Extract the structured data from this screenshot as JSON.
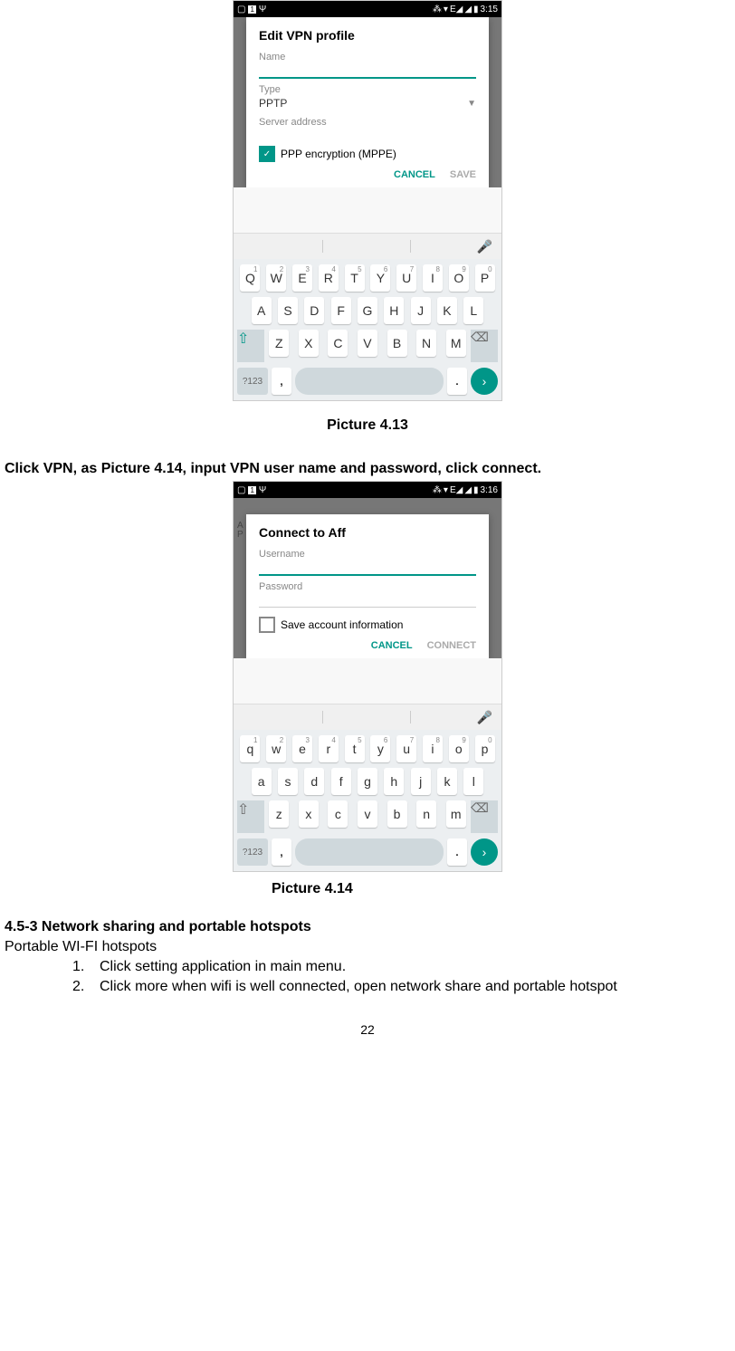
{
  "screenshot1": {
    "status_time": "3:15",
    "dialog_title": "Edit VPN profile",
    "name_label": "Name",
    "type_label": "Type",
    "type_value": "PPTP",
    "server_label": "Server address",
    "checkbox_label": "PPP encryption (MPPE)",
    "cancel": "CANCEL",
    "save": "SAVE",
    "keys_row1": [
      {
        "k": "Q",
        "s": "1"
      },
      {
        "k": "W",
        "s": "2"
      },
      {
        "k": "E",
        "s": "3"
      },
      {
        "k": "R",
        "s": "4"
      },
      {
        "k": "T",
        "s": "5"
      },
      {
        "k": "Y",
        "s": "6"
      },
      {
        "k": "U",
        "s": "7"
      },
      {
        "k": "I",
        "s": "8"
      },
      {
        "k": "O",
        "s": "9"
      },
      {
        "k": "P",
        "s": "0"
      }
    ],
    "keys_row2": [
      "A",
      "S",
      "D",
      "F",
      "G",
      "H",
      "J",
      "K",
      "L"
    ],
    "keys_row3": [
      "Z",
      "X",
      "C",
      "V",
      "B",
      "N",
      "M"
    ],
    "key_123": "?123"
  },
  "caption1": "Picture 4.13",
  "para1": "Click VPN, as Picture 4.14, input VPN user name and password, click connect.",
  "screenshot2": {
    "status_time": "3:16",
    "back_a": "A",
    "back_p": "P",
    "dialog_title": "Connect to Aff",
    "username_label": "Username",
    "password_label": "Password",
    "checkbox_label": "Save account information",
    "cancel": "CANCEL",
    "connect": "CONNECT",
    "keys_row1": [
      {
        "k": "q",
        "s": "1"
      },
      {
        "k": "w",
        "s": "2"
      },
      {
        "k": "e",
        "s": "3"
      },
      {
        "k": "r",
        "s": "4"
      },
      {
        "k": "t",
        "s": "5"
      },
      {
        "k": "y",
        "s": "6"
      },
      {
        "k": "u",
        "s": "7"
      },
      {
        "k": "i",
        "s": "8"
      },
      {
        "k": "o",
        "s": "9"
      },
      {
        "k": "p",
        "s": "0"
      }
    ],
    "keys_row2": [
      "a",
      "s",
      "d",
      "f",
      "g",
      "h",
      "j",
      "k",
      "l"
    ],
    "keys_row3": [
      "z",
      "x",
      "c",
      "v",
      "b",
      "n",
      "m"
    ],
    "key_123": "?123"
  },
  "caption2": "Picture 4.14",
  "heading": "4.5-3 Network sharing and portable hotspots",
  "subheading": "Portable WI-FI hotspots",
  "list": [
    {
      "n": "1.",
      "t": "Click setting application in main menu."
    },
    {
      "n": "2.",
      "t": "Click more when wifi is well connected, open network share and portable hotspot"
    }
  ],
  "page_number": "22"
}
